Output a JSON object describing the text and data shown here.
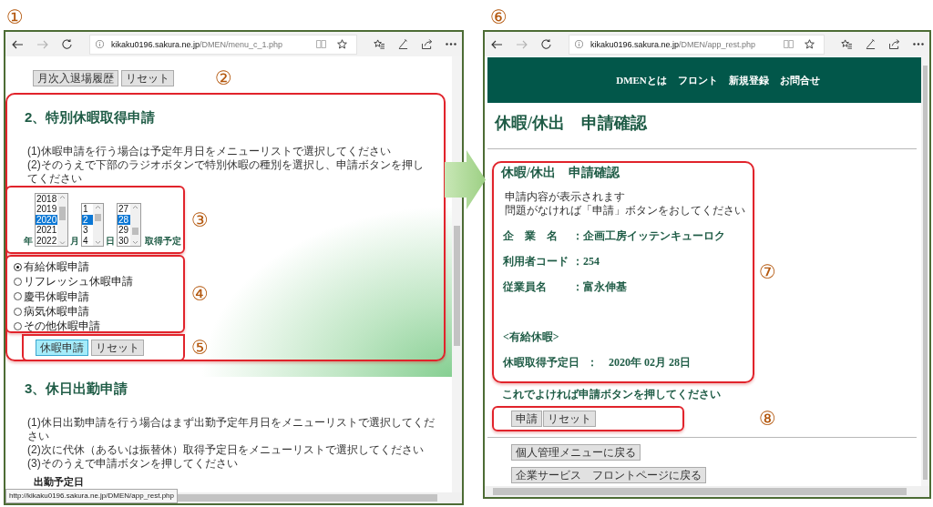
{
  "left_window": {
    "marker": "①",
    "address": {
      "host": "kikaku0196.sakura.ne.jp",
      "path": "/DMEN/menu_c_1.php"
    },
    "history_buttons": [
      "月次入退場履歴",
      "リセット"
    ],
    "callout": "②",
    "special_leave": {
      "title": "2、特別休暇取得申請",
      "instructions": [
        "(1)休暇申請を行う場合は予定年月日をメニューリストで選択してください",
        "(2)そのうえで下部のラジオボタンで特別休暇の種別を選択し、申請ボタンを押してください"
      ],
      "date_picker": {
        "callout": "③",
        "lists": [
          {
            "label": "年",
            "options": [
              {
                "label": "2018",
                "selected": false
              },
              {
                "label": "2019",
                "selected": false
              },
              {
                "label": "2020",
                "selected": true
              },
              {
                "label": "2021",
                "selected": false
              },
              {
                "label": "2022",
                "selected": false
              }
            ]
          },
          {
            "label": "月",
            "options": [
              {
                "label": "1",
                "selected": false
              },
              {
                "label": "2",
                "selected": true
              },
              {
                "label": "3",
                "selected": false
              },
              {
                "label": "4",
                "selected": false
              }
            ]
          },
          {
            "label": "日",
            "options": [
              {
                "label": "27",
                "selected": false
              },
              {
                "label": "28",
                "selected": true
              },
              {
                "label": "29",
                "selected": false
              },
              {
                "label": "30",
                "selected": false
              }
            ]
          }
        ],
        "suffix": "取得予定"
      },
      "leave_types": {
        "callout": "④",
        "options": [
          {
            "label": "有給休暇申請",
            "selected": true
          },
          {
            "label": "リフレッシュ休暇申請",
            "selected": false
          },
          {
            "label": "慶弔休暇申請",
            "selected": false
          },
          {
            "label": "病気休暇申請",
            "selected": false
          },
          {
            "label": "その他休暇申請",
            "selected": false
          }
        ]
      },
      "actions": {
        "callout": "⑤",
        "buttons": [
          {
            "label": "休暇申請",
            "highlighted": true
          },
          {
            "label": "リセット",
            "highlighted": false
          }
        ]
      }
    },
    "holiday_work": {
      "title": "3、休日出勤申請",
      "instructions": [
        "(1)休日出勤申請を行う場合はまず出勤予定年月日をメニューリストで選択してください",
        "(2)次に代休（あるいは振替休）取得予定日をメニューリストで選択してください",
        "(3)そのうえで申請ボタンを押してください"
      ],
      "field_label": "出勤予定日"
    },
    "status_url": "http://kikaku0196.sakura.ne.jp/DMEN/app_rest.php"
  },
  "right_window": {
    "marker": "⑥",
    "address": {
      "host": "kikaku0196.sakura.ne.jp",
      "path": "/DMEN/app_rest.php"
    },
    "nav": [
      "DMENとは",
      "フロント",
      "新規登録",
      "お問合せ"
    ],
    "page_title": "休暇/休出　申請確認",
    "confirmation": {
      "callout": "⑦",
      "title": "休暇/休出　申請確認",
      "notes": [
        "申請内容が表示されます",
        "問題がなければ「申請」ボタンをおしてください"
      ],
      "fields": [
        {
          "label": "企　業　名",
          "value": "：企画工房イッテンキューロク"
        },
        {
          "label": "利用者コード",
          "value": "：254"
        },
        {
          "label": "従業員名",
          "value": "：富永伸基"
        }
      ],
      "leave_type": "<有給休暇>",
      "date": {
        "label": "休暇取得予定日",
        "value": "：　2020年 02月 28日"
      }
    },
    "prompt": "これでよければ申請ボタンを押してください",
    "actions": {
      "callout": "⑧",
      "buttons": [
        "申請",
        "リセット"
      ]
    },
    "back_buttons": [
      "個人管理メニューに戻る",
      "企業サービス　フロントページに戻る"
    ]
  }
}
